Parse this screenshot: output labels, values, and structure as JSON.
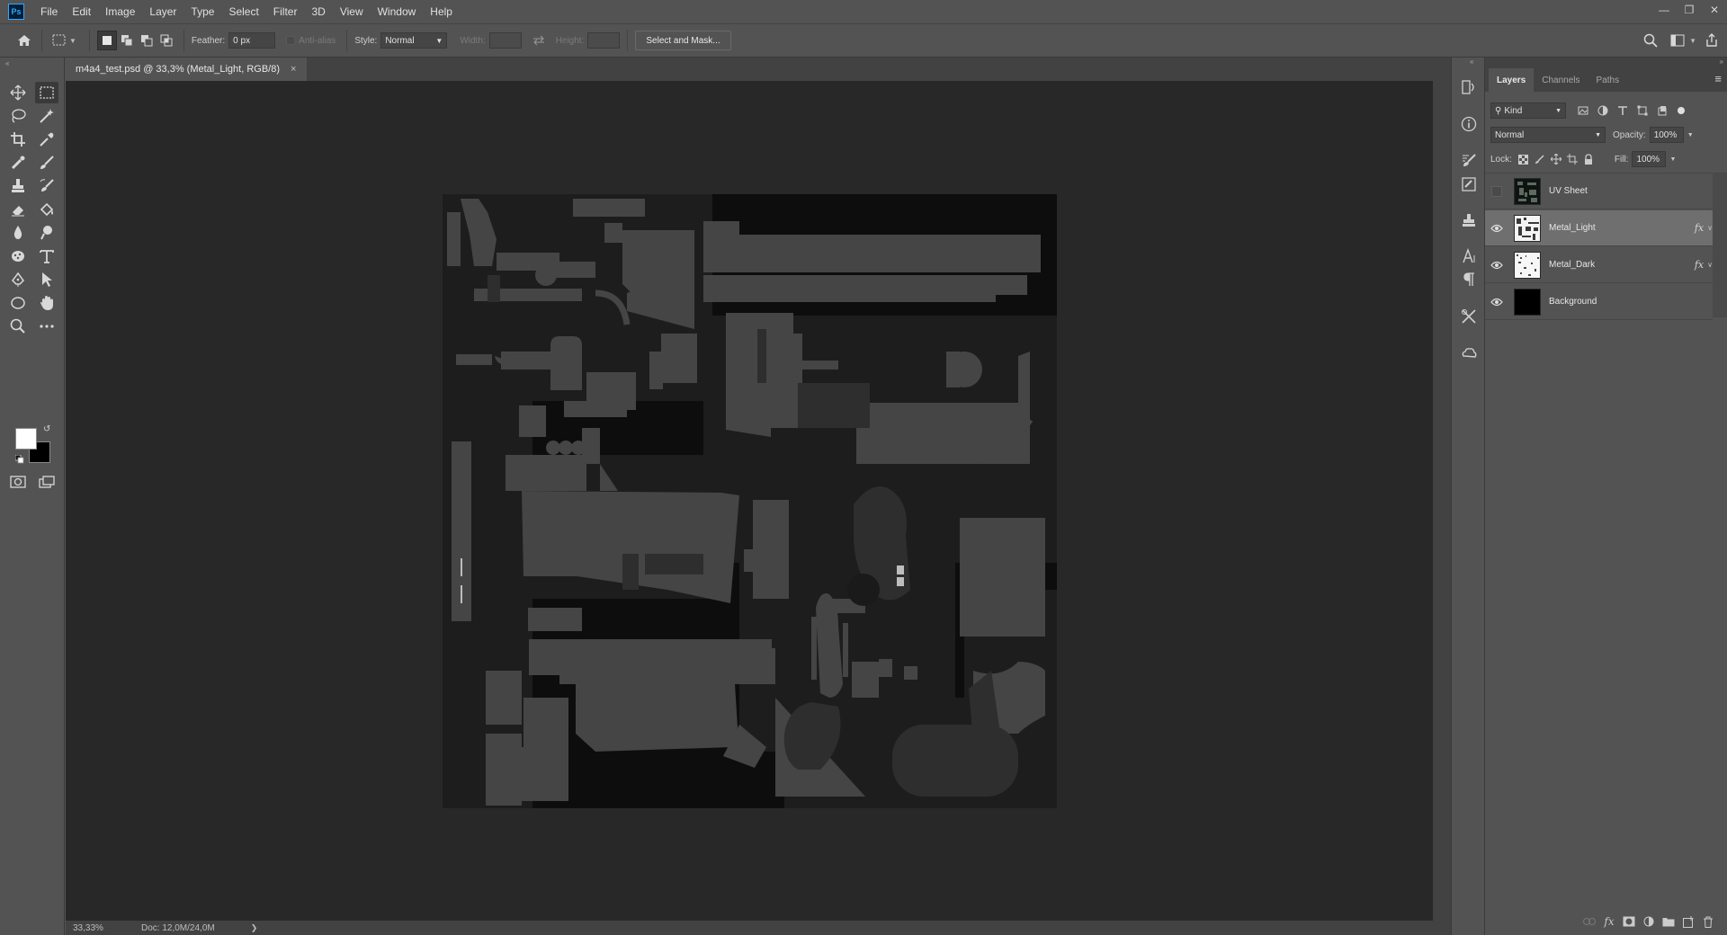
{
  "app": {
    "logo": "Ps",
    "menu": [
      "File",
      "Edit",
      "Image",
      "Layer",
      "Type",
      "Select",
      "Filter",
      "3D",
      "View",
      "Window",
      "Help"
    ],
    "window_controls": [
      "minimize-icon",
      "restore-icon",
      "close-icon"
    ]
  },
  "options": {
    "feather_label": "Feather:",
    "feather_value": "0 px",
    "antialias_label": "Anti-alias",
    "style_label": "Style:",
    "style_value": "Normal",
    "width_label": "Width:",
    "height_label": "Height:",
    "select_mask_label": "Select and Mask..."
  },
  "document": {
    "tab_title": "m4a4_test.psd @ 33,3% (Metal_Light, RGB/8)",
    "tab_close": "×",
    "zoom": "33,33%",
    "doc_info": "Doc: 12,0M/24,0M",
    "status_arrow": "❯"
  },
  "layers_panel": {
    "tabs": [
      "Layers",
      "Channels",
      "Paths"
    ],
    "active_tab": "Layers",
    "filter_kind": "Kind",
    "blend_mode": "Normal",
    "opacity_label": "Opacity:",
    "opacity_value": "100%",
    "lock_label": "Lock:",
    "fill_label": "Fill:",
    "fill_value": "100%",
    "layers": [
      {
        "name": "UV Sheet",
        "visible": false,
        "selected": false,
        "fx": ""
      },
      {
        "name": "Metal_Light",
        "visible": true,
        "selected": true,
        "fx": "fx"
      },
      {
        "name": "Metal_Dark",
        "visible": true,
        "selected": false,
        "fx": "fx"
      },
      {
        "name": "Background",
        "visible": true,
        "selected": false,
        "fx": ""
      }
    ]
  },
  "colors": {
    "ui_panel": "#535353",
    "canvas_bg": "#282828",
    "uv_shape": "#454545",
    "uv_shape_dark": "#2e2e2e",
    "image_bg": "#0d0d0d",
    "accent": "#31a8ff"
  }
}
